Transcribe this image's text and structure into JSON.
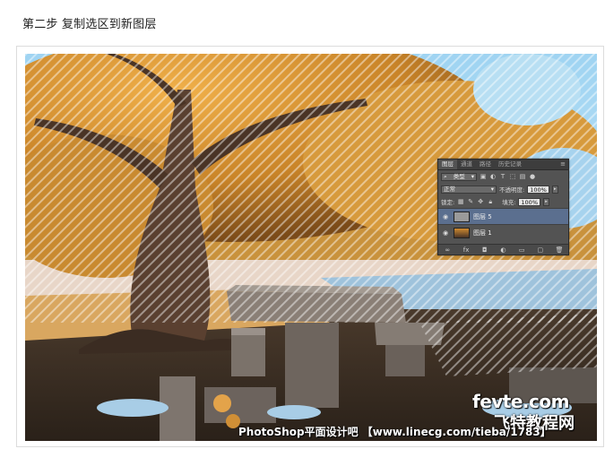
{
  "article": {
    "step_title": "第二步 复制选区到新图层"
  },
  "ps_panel": {
    "tabs": [
      "图层",
      "通道",
      "路径",
      "历史记录"
    ],
    "menu_icon": "panel-menu-icon",
    "filter_label": "类型",
    "blend_mode": "正常",
    "opacity_label": "不透明度:",
    "opacity_value": "100%",
    "lock_label": "锁定:",
    "fill_label": "填充:",
    "fill_value": "100%",
    "layers": [
      {
        "name": "图层 5",
        "selected": true
      },
      {
        "name": "图层 1",
        "selected": false
      }
    ]
  },
  "watermarks": {
    "site_logo": "fevte.com",
    "site_name": "飞特教程网",
    "bottom": "PhotoShop平面设计吧 【www.linecg.com/tieba/1783】"
  },
  "colors": {
    "selection_overlay": "#ffffff",
    "layer_selected": "#5b6f8f",
    "panel_bg": "#535353"
  }
}
